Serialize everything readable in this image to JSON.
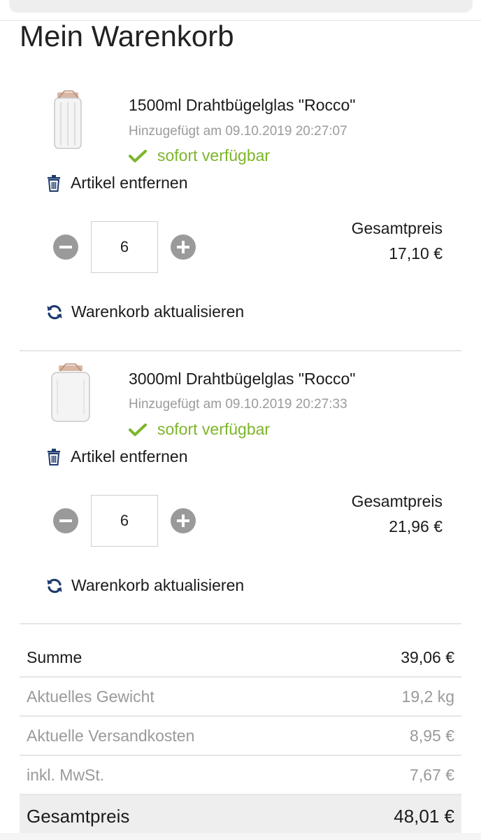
{
  "page": {
    "title": "Mein Warenkorb"
  },
  "items": [
    {
      "name": "1500ml Drahtbügelglas \"Rocco\"",
      "added": "Hinzugefügt am 09.10.2019 20:27:07",
      "availability": "sofort verfügbar",
      "remove_label": "Artikel entfernen",
      "quantity": "6",
      "total_label": "Gesamtpreis",
      "total_value": "17,10 €",
      "update_label": "Warenkorb aktualisieren"
    },
    {
      "name": "3000ml Drahtbügelglas \"Rocco\"",
      "added": "Hinzugefügt am 09.10.2019 20:27:33",
      "availability": "sofort verfügbar",
      "remove_label": "Artikel entfernen",
      "quantity": "6",
      "total_label": "Gesamtpreis",
      "total_value": "21,96 €",
      "update_label": "Warenkorb aktualisieren"
    }
  ],
  "summary": {
    "sum_label": "Summe",
    "sum_value": "39,06 €",
    "weight_label": "Aktuelles Gewicht",
    "weight_value": "19,2 kg",
    "shipping_label": "Aktuelle Versandkosten",
    "shipping_value": "8,95 €",
    "vat_label": "inkl. MwSt.",
    "vat_value": "7,67 €",
    "total_label": "Gesamtpreis",
    "total_value": "48,01 €"
  },
  "colors": {
    "available": "#7cb52a",
    "icon_blue": "#1d3a6e",
    "stepper_gray": "#9a9a9a"
  },
  "icons": [
    "check-icon",
    "trash-icon",
    "minus-icon",
    "plus-icon",
    "sync-icon",
    "jar-image"
  ]
}
